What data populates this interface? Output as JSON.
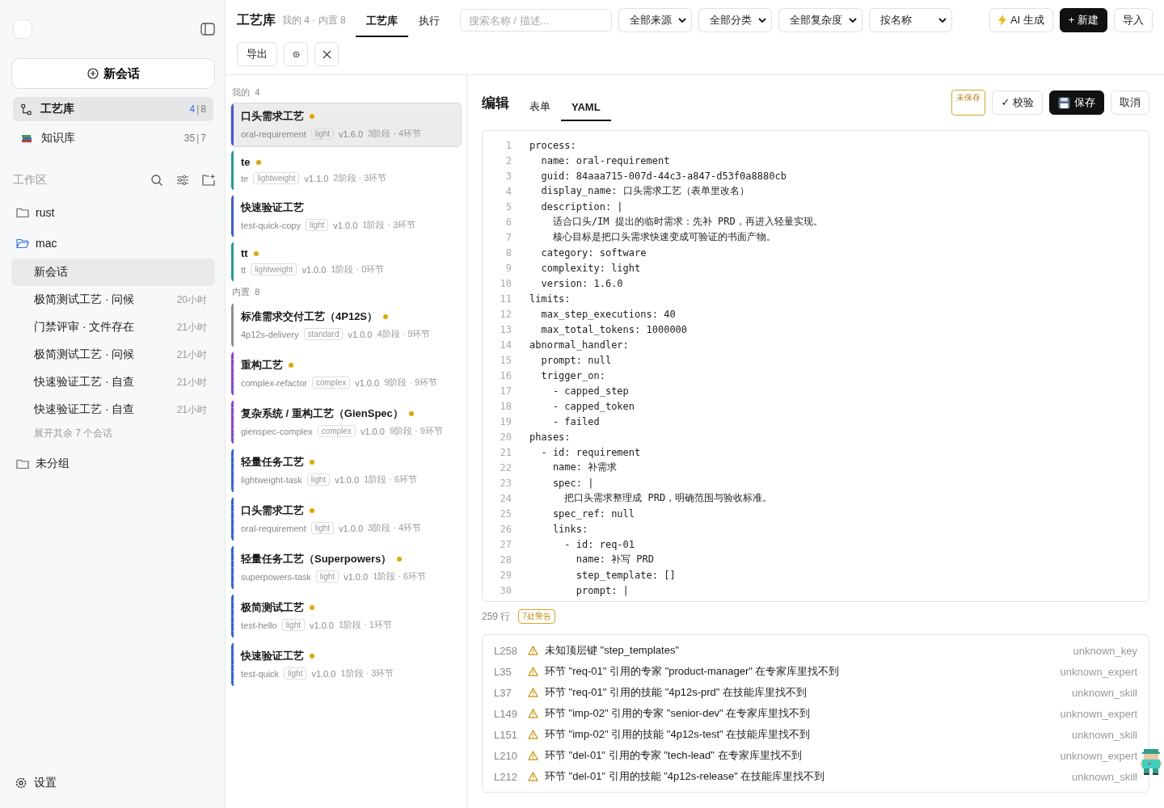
{
  "sidebar": {
    "new_chat": "新会话",
    "nav": [
      {
        "kind": "process",
        "label": "工艺库",
        "selected": true,
        "count_main": "4",
        "count_sep": "|",
        "count_total": "8",
        "highlight": true
      },
      {
        "kind": "books",
        "label": "知识库",
        "selected": false,
        "count_main": "35",
        "count_sep": "|",
        "count_total": "7",
        "highlight": false
      }
    ],
    "workspace_label": "工作区",
    "folders": [
      {
        "name": "rust",
        "expanded": false
      },
      {
        "name": "mac",
        "expanded": true,
        "children": [
          {
            "title": "新会话",
            "selected": true
          },
          {
            "title": "极简测试工艺 · 问候",
            "time": "20小时",
            "selected": false
          },
          {
            "title": "门禁评审 · 文件存在",
            "time": "21小时",
            "selected": false
          },
          {
            "title": "极简测试工艺 · 问候",
            "time": "21小时",
            "selected": false
          },
          {
            "title": "快速验证工艺 · 自查",
            "time": "21小时",
            "selected": false
          },
          {
            "title": "快速验证工艺 · 自查",
            "time": "21小时",
            "selected": false
          }
        ],
        "more": "展开其余 7 个会话"
      },
      {
        "name": "未分组",
        "expanded": false
      }
    ],
    "settings": "设置"
  },
  "topbar": {
    "title": "工艺库",
    "subtitle": "我的 4 · 内置 8",
    "tabs": [
      {
        "label": "工艺库",
        "selected": true
      },
      {
        "label": "执行",
        "selected": false
      }
    ],
    "search": {
      "placeholder": "搜索名称 / 描述..."
    },
    "filters": [
      "全部来源",
      "全部分类",
      "全部复杂度",
      "按名称"
    ],
    "actions": [
      {
        "kind": "ai",
        "label": "AI 生成"
      },
      {
        "kind": "primary",
        "label": "+ 新建"
      },
      {
        "kind": "plain",
        "label": "导入"
      }
    ],
    "row2": [
      {
        "kind": "text",
        "label": "导出"
      },
      {
        "kind": "gear"
      },
      {
        "kind": "close"
      }
    ]
  },
  "library": {
    "sections": [
      {
        "label": "我的",
        "count": "4",
        "kind": "custom",
        "items": [
          {
            "name": "口头需求工艺",
            "modified": true,
            "selected": true,
            "color": "#3b5bdb",
            "slug": "oral-requirement",
            "tag": "light",
            "version": "v1.6.0",
            "stats": "3阶段 · 4环节"
          },
          {
            "name": "te",
            "modified": true,
            "selected": false,
            "color": "#1f9e8f",
            "slug": "te",
            "tag": "lightweight",
            "version": "v1.1.0",
            "stats": "2阶段 · 3环节"
          },
          {
            "name": "快速验证工艺",
            "modified": false,
            "selected": false,
            "color": "#3b5bdb",
            "slug": "test-quick-copy",
            "tag": "light",
            "version": "v1.0.0",
            "stats": "1阶段 · 3环节"
          },
          {
            "name": "tt",
            "modified": true,
            "selected": false,
            "color": "#1f9e8f",
            "slug": "tt",
            "tag": "lightweight",
            "version": "v1.0.0",
            "stats": "1阶段 · 0环节"
          }
        ]
      },
      {
        "label": "内置",
        "count": "8",
        "kind": "builtin",
        "items": [
          {
            "name": "标准需求交付工艺（4P12S）",
            "modified": true,
            "selected": false,
            "color": "#8c8c8c",
            "slug": "4p12s-delivery",
            "tag": "standard",
            "version": "v1.0.0",
            "stats": "4阶段 · 9环节"
          },
          {
            "name": "重构工艺",
            "modified": true,
            "selected": false,
            "color": "#8b3fd9",
            "slug": "complex-refactor",
            "tag": "complex",
            "version": "v1.0.0",
            "stats": "9阶段 · 9环节"
          },
          {
            "name": "复杂系统 / 重构工艺（GienSpec）",
            "modified": true,
            "selected": false,
            "color": "#8b3fd9",
            "slug": "gienspec-complex",
            "tag": "complex",
            "version": "v1.0.0",
            "stats": "9阶段 · 9环节"
          },
          {
            "name": "轻量任务工艺",
            "modified": true,
            "selected": false,
            "color": "#2f5fe8",
            "slug": "lightweight-task",
            "tag": "light",
            "version": "v1.0.0",
            "stats": "1阶段 · 6环节"
          },
          {
            "name": "口头需求工艺",
            "modified": true,
            "selected": false,
            "color": "#2f5fe8",
            "slug": "oral-requirement",
            "tag": "light",
            "version": "v1.0.0",
            "stats": "3阶段 · 4环节"
          },
          {
            "name": "轻量任务工艺（Superpowers）",
            "modified": true,
            "selected": false,
            "color": "#2f5fe8",
            "slug": "superpowers-task",
            "tag": "light",
            "version": "v1.0.0",
            "stats": "1阶段 · 6环节"
          },
          {
            "name": "极简测试工艺",
            "modified": true,
            "selected": false,
            "color": "#2f5fe8",
            "slug": "test-hello",
            "tag": "light",
            "version": "v1.0.0",
            "stats": "1阶段 · 1环节"
          },
          {
            "name": "快速验证工艺",
            "modified": true,
            "selected": false,
            "color": "#2f5fe8",
            "slug": "test-quick",
            "tag": "light",
            "version": "v1.0.0",
            "stats": "1阶段 · 3环节"
          }
        ]
      }
    ]
  },
  "editor": {
    "title": "编辑",
    "tabs": [
      {
        "label": "表单",
        "selected": false
      },
      {
        "label": "YAML",
        "selected": true
      }
    ],
    "unsaved": "未保存",
    "validate": "✓ 校验",
    "save": "保存",
    "cancel": "取消",
    "lines": [
      {
        "n": "1",
        "text": "process:"
      },
      {
        "n": "2",
        "text": "  name: oral-requirement"
      },
      {
        "n": "3",
        "text": "  guid: 84aaa715-007d-44c3-a847-d53f0a8880cb"
      },
      {
        "n": "4",
        "text": "  display_name: 口头需求工艺（表单里改名）"
      },
      {
        "n": "5",
        "text": "  description: |"
      },
      {
        "n": "6",
        "text": "    适合口头/IM 提出的临时需求：先补 PRD，再进入轻量实现。"
      },
      {
        "n": "7",
        "text": "    核心目标是把口头需求快速变成可验证的书面产物。"
      },
      {
        "n": "8",
        "text": "  category: software"
      },
      {
        "n": "9",
        "text": "  complexity: light"
      },
      {
        "n": "10",
        "text": "  version: 1.6.0"
      },
      {
        "n": "11",
        "text": "limits:"
      },
      {
        "n": "12",
        "text": "  max_step_executions: 40"
      },
      {
        "n": "13",
        "text": "  max_total_tokens: 1000000"
      },
      {
        "n": "14",
        "text": "abnormal_handler:"
      },
      {
        "n": "15",
        "text": "  prompt: null"
      },
      {
        "n": "16",
        "text": "  trigger_on:"
      },
      {
        "n": "17",
        "text": "    - capped_step"
      },
      {
        "n": "18",
        "text": "    - capped_token"
      },
      {
        "n": "19",
        "text": "    - failed"
      },
      {
        "n": "20",
        "text": "phases:"
      },
      {
        "n": "21",
        "text": "  - id: requirement"
      },
      {
        "n": "22",
        "text": "    name: 补需求"
      },
      {
        "n": "23",
        "text": "    spec: |"
      },
      {
        "n": "24",
        "text": "      把口头需求整理成 PRD，明确范围与验收标准。"
      },
      {
        "n": "25",
        "text": "    spec_ref: null"
      },
      {
        "n": "26",
        "text": "    links:"
      },
      {
        "n": "27",
        "text": "      - id: req-01"
      },
      {
        "n": "28",
        "text": "        name: 补写 PRD"
      },
      {
        "n": "29",
        "text": "        step_template: []"
      },
      {
        "n": "30",
        "text": "        prompt: |"
      }
    ],
    "line_count": "259 行",
    "warning_count": "7处警告",
    "warnings": [
      {
        "line": "L258",
        "message": "未知顶层键 \"step_templates\"",
        "code": "unknown_key"
      },
      {
        "line": "L35",
        "message": "环节 \"req-01\" 引用的专家 \"product-manager\" 在专家库里找不到",
        "code": "unknown_expert"
      },
      {
        "line": "L37",
        "message": "环节 \"req-01\" 引用的技能 \"4p12s-prd\" 在技能库里找不到",
        "code": "unknown_skill"
      },
      {
        "line": "L149",
        "message": "环节 \"imp-02\" 引用的专家 \"senior-dev\" 在专家库里找不到",
        "code": "unknown_expert"
      },
      {
        "line": "L151",
        "message": "环节 \"imp-02\" 引用的技能 \"4p12s-test\" 在技能库里找不到",
        "code": "unknown_skill"
      },
      {
        "line": "L210",
        "message": "环节 \"del-01\" 引用的专家 \"tech-lead\" 在专家库里找不到",
        "code": "unknown_expert"
      },
      {
        "line": "L212",
        "message": "环节 \"del-01\" 引用的技能 \"4p12s-release\" 在技能库里找不到",
        "code": "unknown_skill"
      }
    ]
  }
}
